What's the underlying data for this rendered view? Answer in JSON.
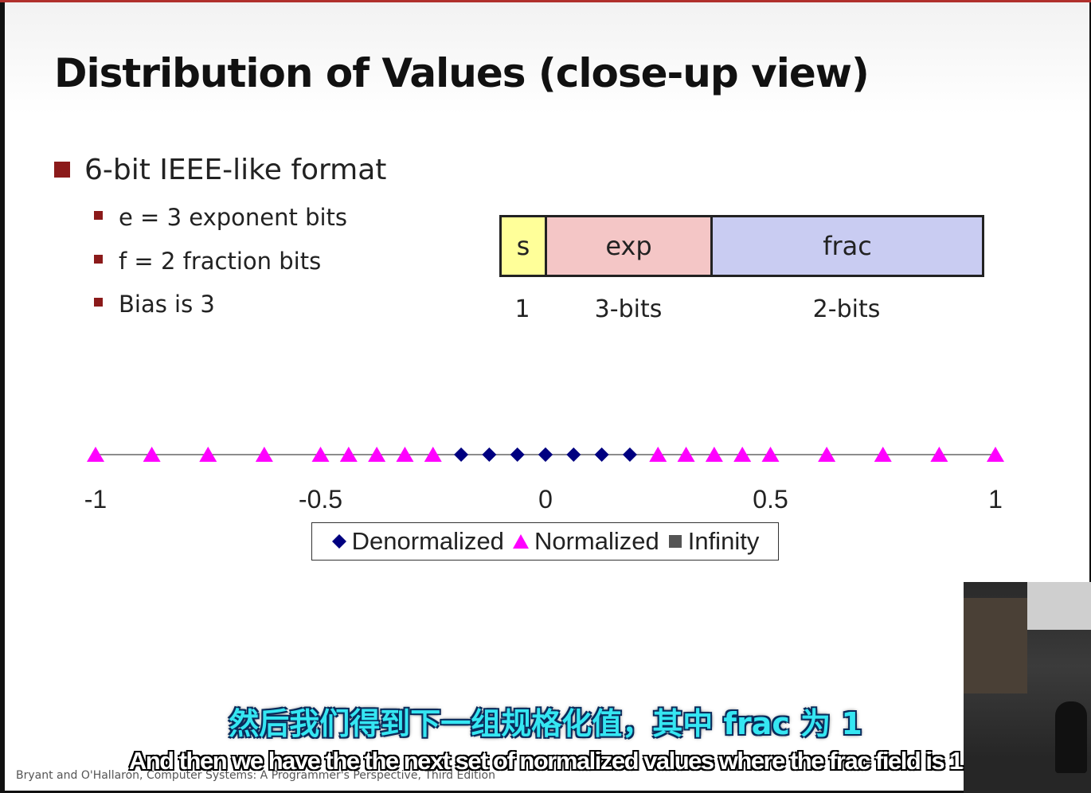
{
  "slide": {
    "title": "Distribution of Values (close-up view)",
    "bullet": "6-bit IEEE-like format",
    "sub_bullets": [
      "e = 3 exponent bits",
      "f = 2 fraction bits",
      "Bias is 3"
    ],
    "footer": "Bryant and O'Hallaron, Computer Systems: A Programmer's Perspective, Third Edition"
  },
  "bit_format": {
    "fields": [
      {
        "name": "s",
        "bits": "1",
        "color": "#ffff99"
      },
      {
        "name": "exp",
        "bits": "3-bits",
        "color": "#f4c6c6"
      },
      {
        "name": "frac",
        "bits": "2-bits",
        "color": "#c9ccf2"
      }
    ]
  },
  "chart_data": {
    "type": "scatter",
    "xlim": [
      -1,
      1
    ],
    "x_ticks": [
      "-1",
      "-0.5",
      "0",
      "0.5",
      "1"
    ],
    "x_tick_values": [
      -1,
      -0.5,
      0,
      0.5,
      1
    ],
    "series": [
      {
        "name": "Denormalized",
        "marker": "diamond",
        "color": "#000080",
        "x": [
          -0.1875,
          -0.125,
          -0.0625,
          0,
          0,
          0.0625,
          0.125,
          0.1875
        ]
      },
      {
        "name": "Normalized",
        "marker": "triangle",
        "color": "#ff00ff",
        "x": [
          -1,
          -0.875,
          -0.75,
          -0.625,
          -0.5,
          -0.4375,
          -0.375,
          -0.3125,
          -0.25,
          0.25,
          0.3125,
          0.375,
          0.4375,
          0.5,
          0.625,
          0.75,
          0.875,
          1
        ]
      },
      {
        "name": "Infinity",
        "marker": "square",
        "color": "#555555",
        "x": []
      }
    ],
    "legend": "bottom"
  },
  "subtitles": {
    "chinese": "然后我们得到下一组规格化值，其中 frac 为 1",
    "english": "And then we have the the next set of normalized values where the frac field is 1"
  }
}
